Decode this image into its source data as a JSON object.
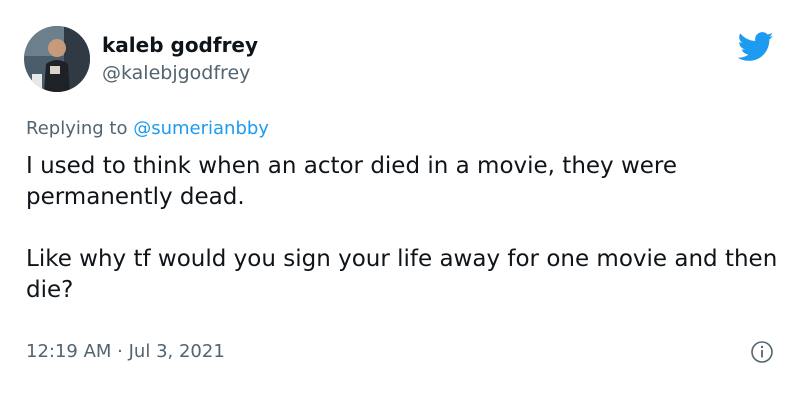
{
  "author": {
    "display_name": "kaleb godfrey",
    "handle": "@kalebjgodfrey"
  },
  "reply": {
    "prefix": "Replying to ",
    "mention": "@sumerianbby"
  },
  "tweet": {
    "paragraphs": [
      "I used to think when an actor died in a movie, they were permanently dead.",
      "Like why tf would you sign your life away for one movie and then die?"
    ],
    "time": "12:19 AM",
    "separator": " · ",
    "date": "Jul 3, 2021"
  },
  "icons": {
    "logo": "twitter-bird-icon",
    "info": "info-icon"
  },
  "colors": {
    "brand": "#1d9bf0",
    "secondary_text": "#536471",
    "primary_text": "#0f1419"
  }
}
